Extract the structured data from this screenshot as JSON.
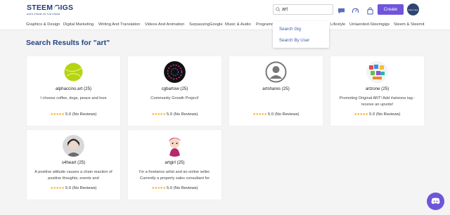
{
  "header": {
    "logo": {
      "word_left": "STEEM",
      "word_right": "GIGS",
      "tagline": "EARN STEEM ON THE STEEM"
    },
    "search": {
      "value": "art",
      "placeholder": ""
    },
    "create_label": "Create",
    "user_avatar_text": "steem app"
  },
  "categories": [
    "Graphics & Design",
    "Digital Marketing",
    "Writing And Translation",
    "Videos And Animation",
    "SurpassingGoogle",
    "Music & Audio",
    "Programming",
    "Lifestyle",
    "Unlaenited-Steemgigs",
    "Steem & Steemit"
  ],
  "dropdown": {
    "items": [
      "Search Gig",
      "Search By User"
    ]
  },
  "page": {
    "title": "Search Results for \"art\""
  },
  "results": [
    {
      "name": "alphaccino.art (25)",
      "desc": "I choose coffee, dogs, peace and love",
      "stars": "★★★★★",
      "rating": "5.0 (No Reviews)",
      "avatar": "green-ball"
    },
    {
      "name": "cgbartow (25)",
      "desc": "Community Growth Project!",
      "stars": "★★★★★",
      "rating": "5.0 (No Reviews)",
      "avatar": "dark-circle"
    },
    {
      "name": "artshares (25)",
      "desc": "",
      "stars": "★★★★★",
      "rating": "5.0 (No Reviews)",
      "avatar": "default-user"
    },
    {
      "name": "artzone (25)",
      "desc": "Promoting Original ART! Add #artzone tag - receive an upvote!",
      "stars": "★★★★★",
      "rating": "5.0 (No Reviews)",
      "avatar": "colorful"
    },
    {
      "name": "s4heart (25)",
      "desc": "A positive attitude causes a chain reaction of positive thoughts, events and",
      "stars": "★★★★★",
      "rating": "5.0 (No Reviews)",
      "avatar": "portrait"
    },
    {
      "name": "artgirl (25)",
      "desc": "I'm a freelance artist and an online seller. Currently a property sales consultant for",
      "stars": "★★★★★",
      "rating": "5.0 (No Reviews)",
      "avatar": "cartoon"
    }
  ],
  "colors": {
    "accent": "#6f55d9",
    "title": "#24437f",
    "star": "#f5a623",
    "link": "#3f5aa8"
  }
}
